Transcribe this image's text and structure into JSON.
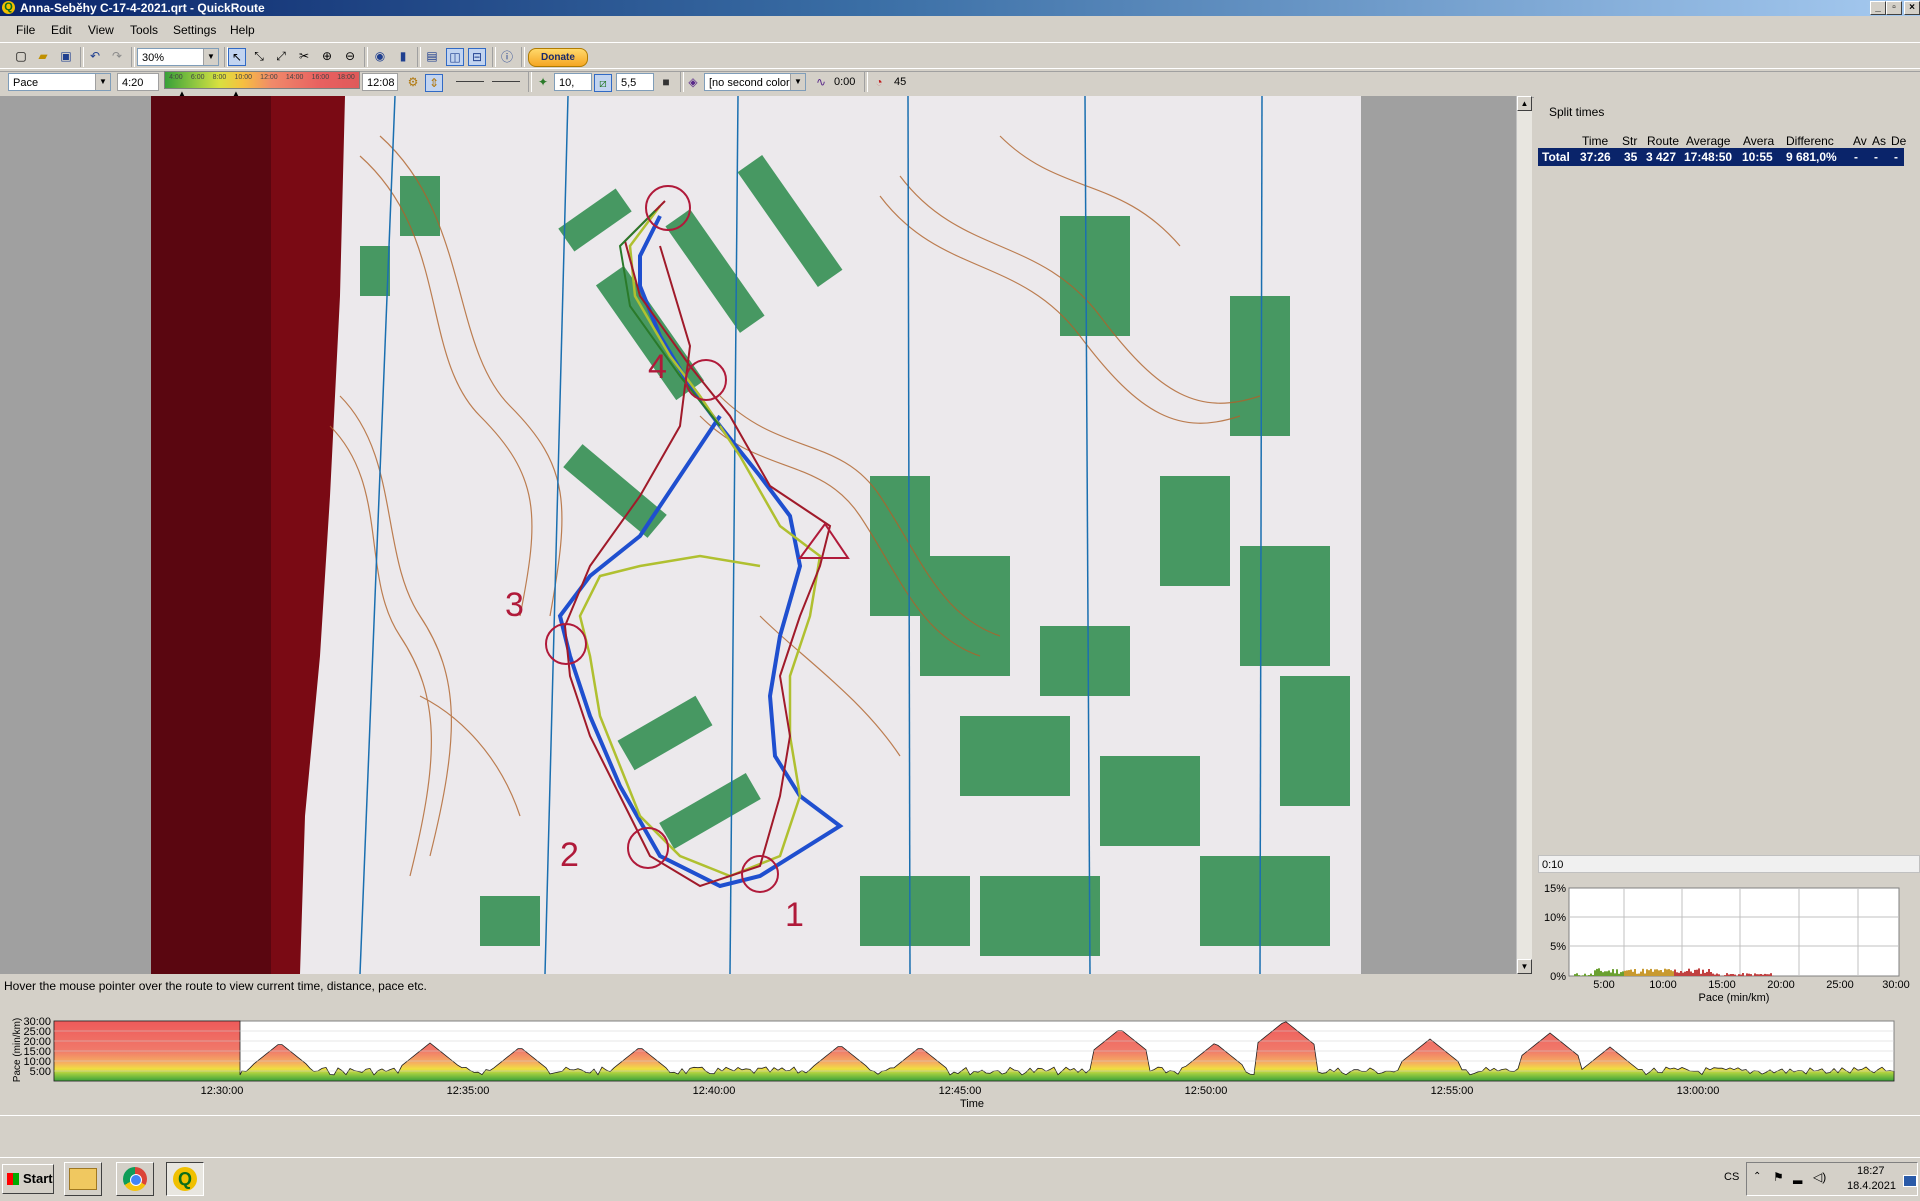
{
  "window": {
    "title": "Anna-Seběhy C-17-4-2021.qrt - QuickRoute"
  },
  "menu": [
    "File",
    "Edit",
    "View",
    "Tools",
    "Settings",
    "Help"
  ],
  "toolbar1": {
    "zoom": "30%",
    "donate": "Donate"
  },
  "toolbar2": {
    "color_by": "Pace",
    "low_value": "4:20",
    "scale_ticks": [
      "4:00",
      "6:00",
      "8:00",
      "10:00",
      "12:00",
      "14:00",
      "16:00",
      "18:00"
    ],
    "high_value": "12:08",
    "route_width": "10,",
    "mask_width": "5,5",
    "second_color": "[no second color",
    "smoothing": "0:00",
    "circle_time": "45"
  },
  "split_times": {
    "label": "Split times",
    "columns": [
      "Time",
      "Str",
      "Route",
      "Average",
      "Avera",
      "Differenc",
      "Av",
      "As",
      "De"
    ],
    "total_row": {
      "label": "Total",
      "time": "37:26",
      "str": "35",
      "route": "3 427",
      "average": "17:48:50",
      "avera": "10:55",
      "difference": "9 681,0%",
      "av": "-",
      "as": "-",
      "de": "-"
    }
  },
  "histogram": {
    "input_value": "0:10",
    "y_ticks": [
      "15%",
      "10%",
      "5%",
      "0%"
    ],
    "x_ticks": [
      "5:00",
      "10:00",
      "15:00",
      "20:00",
      "25:00",
      "30:00"
    ],
    "x_label": "Pace (min/km)"
  },
  "status_text": "Hover the mouse pointer over the route to view current time, distance, pace etc.",
  "line_graph": {
    "y_label": "Pace (min/km)",
    "y_ticks": [
      "30:00",
      "25:00",
      "20:00",
      "15:00",
      "10:00",
      "5:00"
    ],
    "x_ticks": [
      "12:30:00",
      "12:35:00",
      "12:40:00",
      "12:45:00",
      "12:50:00",
      "12:55:00",
      "13:00:00"
    ],
    "x_label": "Time"
  },
  "map": {
    "control_labels": [
      "1",
      "2",
      "3",
      "4"
    ]
  },
  "taskbar": {
    "start": "Start",
    "lang": "CS",
    "time": "18:27",
    "date": "18.4.2021"
  }
}
